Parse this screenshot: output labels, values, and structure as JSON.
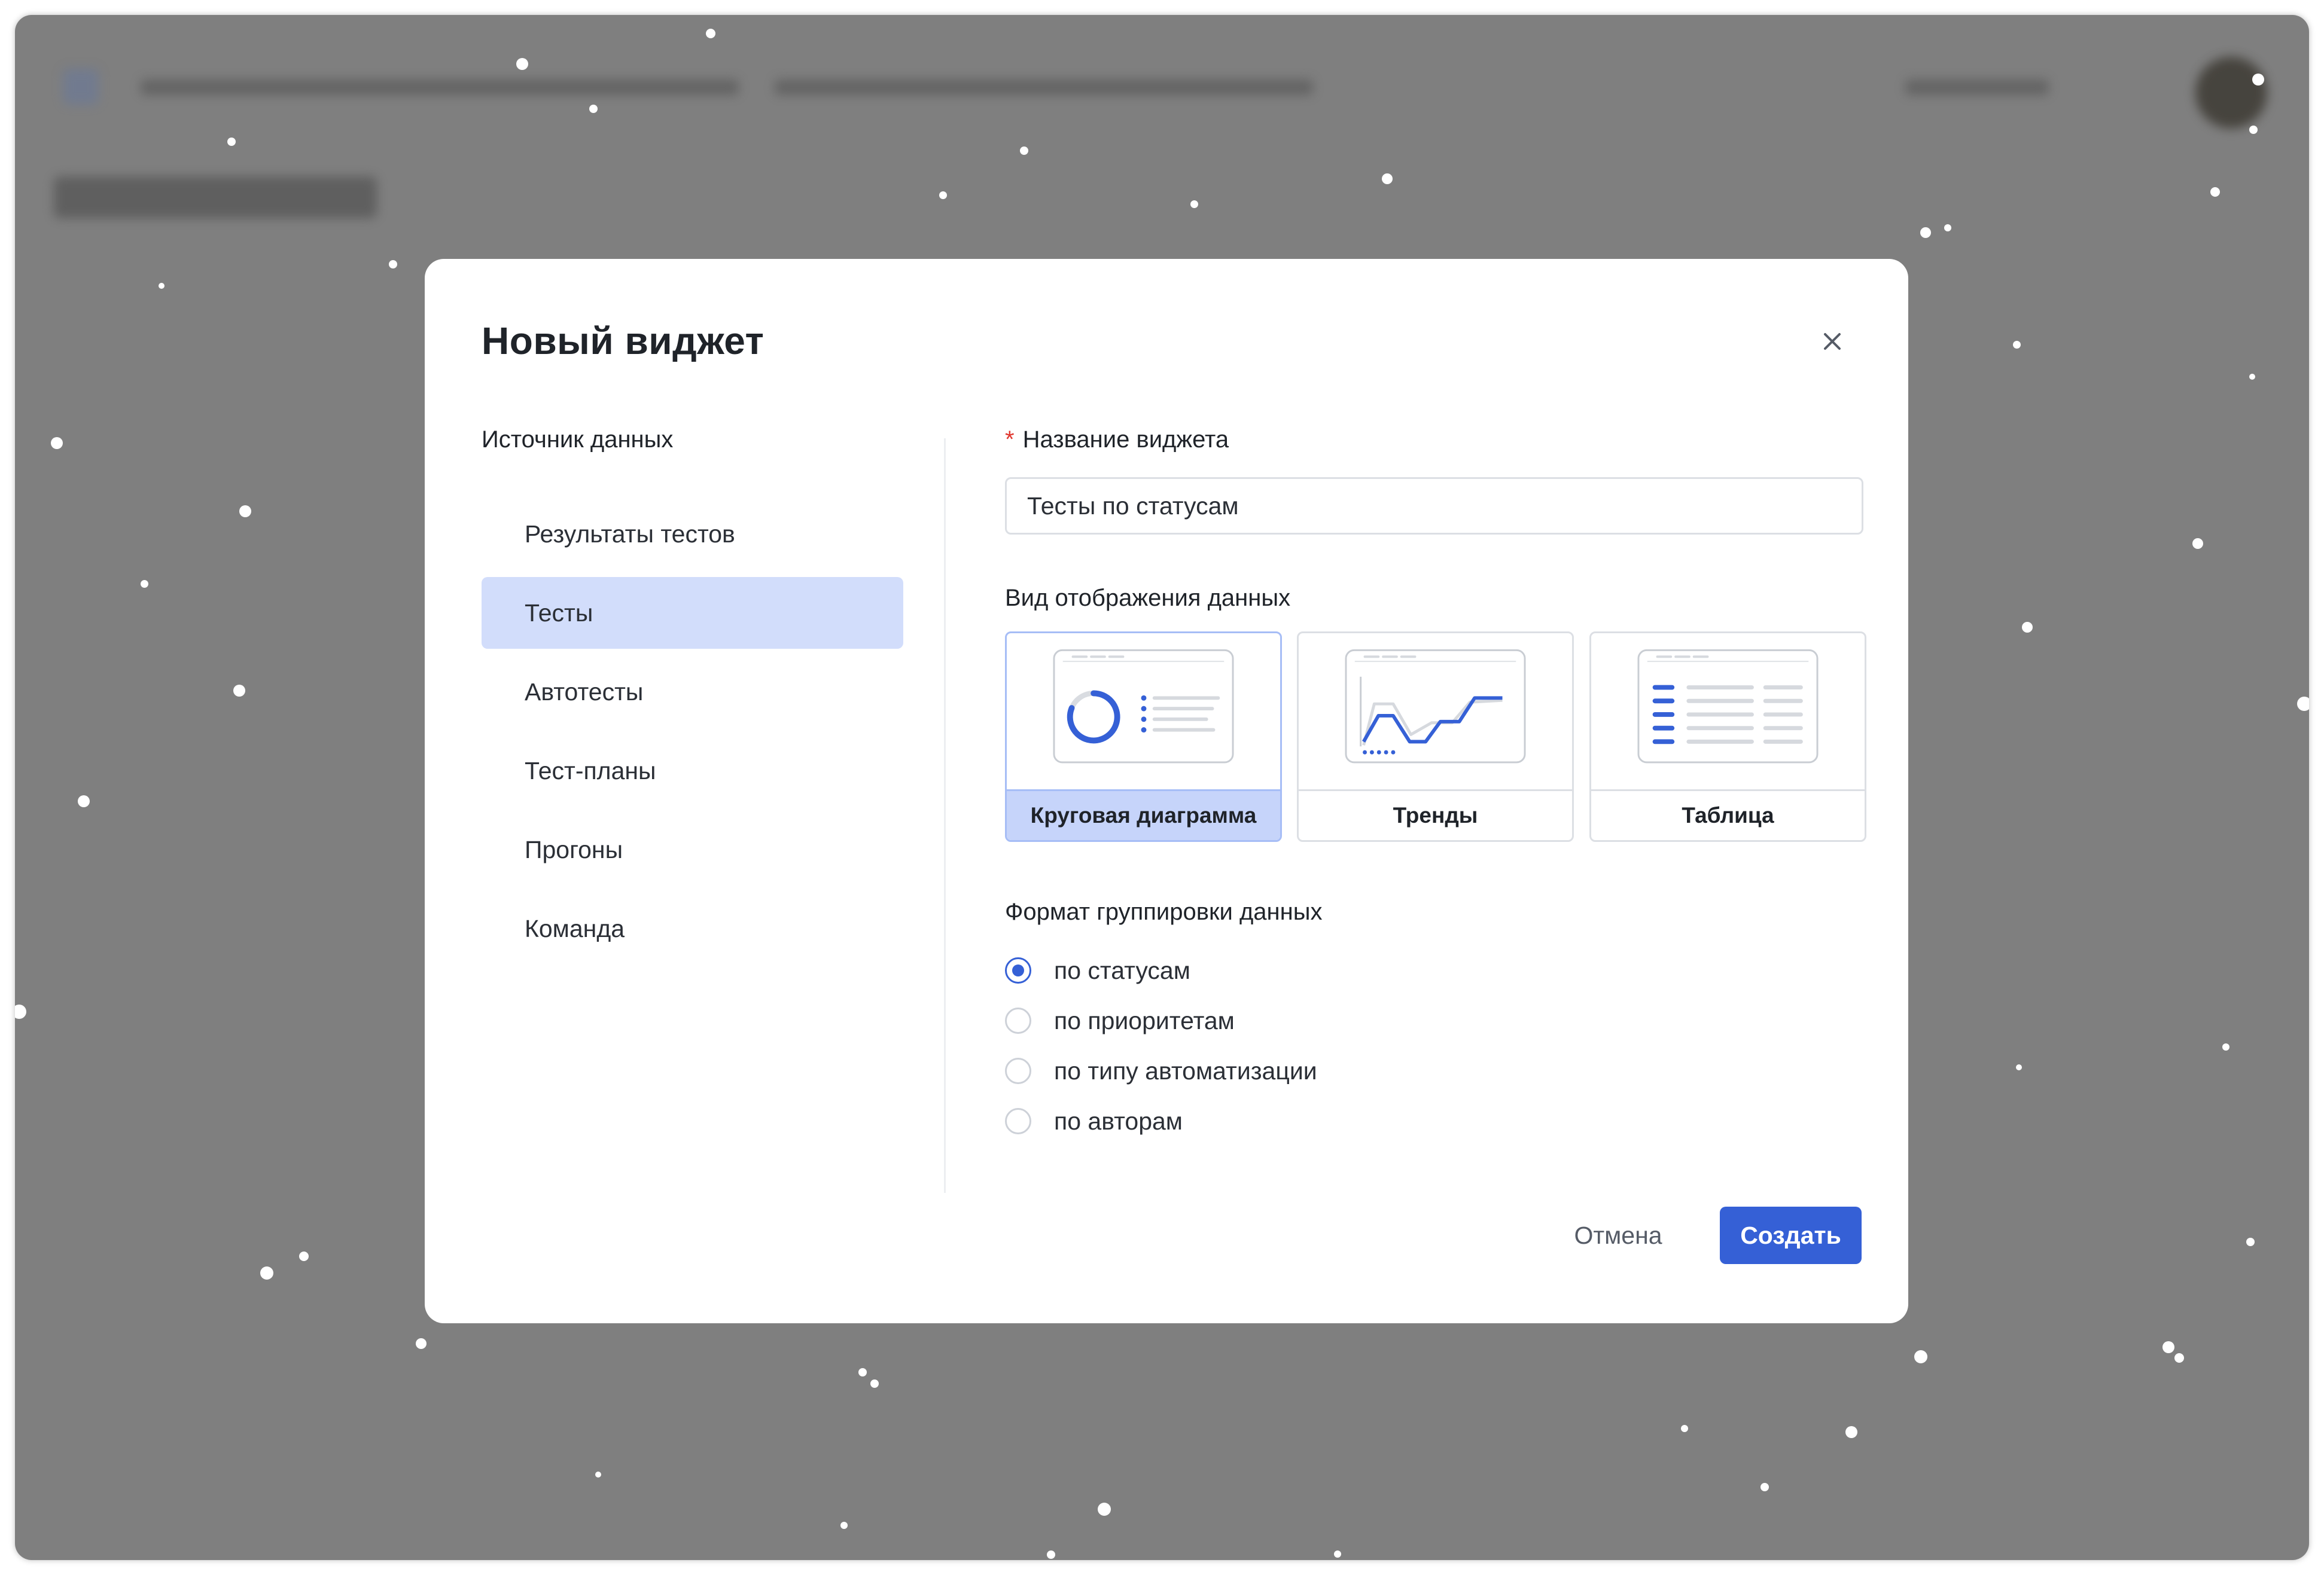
{
  "modal": {
    "title": "Новый виджет",
    "close_icon": "close-icon"
  },
  "source": {
    "label": "Источник данных",
    "items": [
      {
        "label": "Результаты тестов",
        "active": false
      },
      {
        "label": "Тесты",
        "active": true
      },
      {
        "label": "Автотесты",
        "active": false
      },
      {
        "label": "Тест-планы",
        "active": false
      },
      {
        "label": "Прогоны",
        "active": false
      },
      {
        "label": "Команда",
        "active": false
      }
    ]
  },
  "form": {
    "name_label": "Название виджета",
    "required_mark": "*",
    "name_value": "Тесты по статусам",
    "view_label": "Вид отображения данных",
    "views": [
      {
        "label": "Круговая диаграмма",
        "icon": "pie-chart-icon",
        "selected": true
      },
      {
        "label": "Тренды",
        "icon": "trend-chart-icon",
        "selected": false
      },
      {
        "label": "Таблица",
        "icon": "table-icon",
        "selected": false
      }
    ],
    "group_label": "Формат группировки данных",
    "groupings": [
      {
        "label": "по статусам",
        "checked": true
      },
      {
        "label": "по приоритетам",
        "checked": false
      },
      {
        "label": "по типу автоматизации",
        "checked": false
      },
      {
        "label": "по авторам",
        "checked": false
      }
    ]
  },
  "actions": {
    "cancel": "Отмена",
    "create": "Создать"
  },
  "colors": {
    "accent": "#3560d6",
    "selected_bg": "#d2ddfb",
    "overlay": "#7f7f7f"
  }
}
